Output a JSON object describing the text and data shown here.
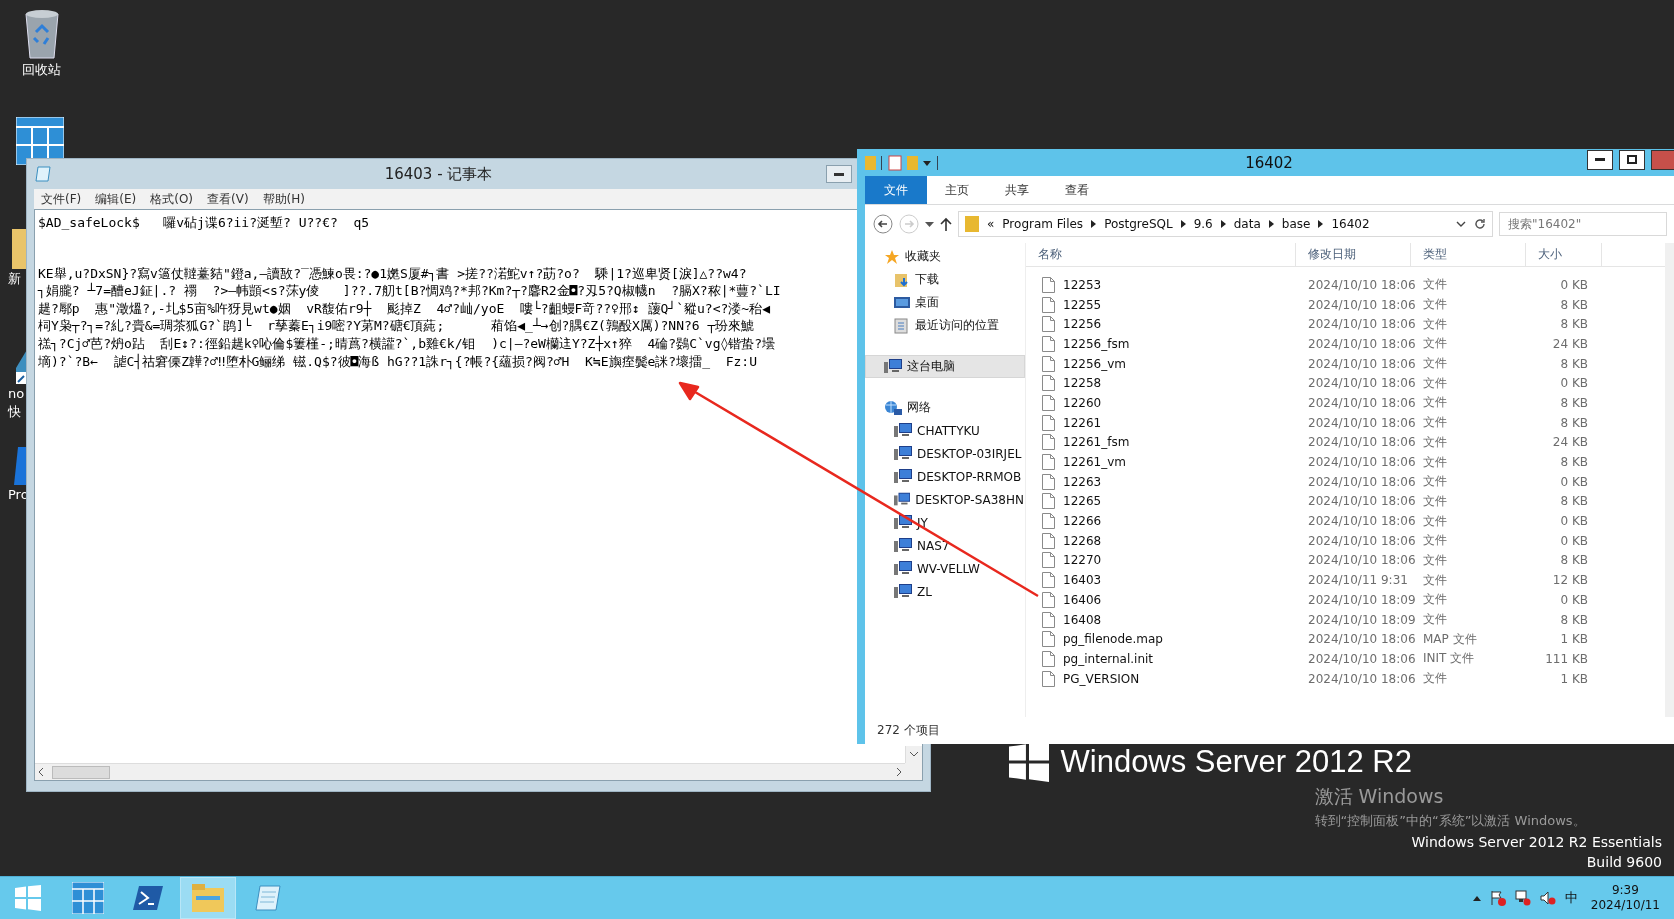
{
  "desktop": {
    "icons": [
      {
        "kind": "recycle-bin",
        "lines": [
          "回收站"
        ]
      },
      {
        "kind": "server"
      },
      {
        "kind": "folder",
        "lines": [
          "新"
        ]
      },
      {
        "kind": "shortcut",
        "lines": [
          "no",
          "快"
        ]
      },
      {
        "kind": "app",
        "lines": [
          "Pro"
        ]
      }
    ]
  },
  "notepad": {
    "title": "16403 - 记事本",
    "menu": [
      "文件(F)",
      "编辑(E)",
      "格式(O)",
      "查看(V)",
      "帮助(H)"
    ],
    "blocks": [
      {
        "lines": [
          "$AD_safeLock$   囉v砧j谍6?ii?涎塹? U??€?  q5"
        ]
      },
      {
        "lines": [
          "KE舉,u?DxSN}?寫v簻仗韃薹夡\"鐙a,–讀敔?‾憑鰊o畏:?●1嬎S厦#┐書 >搓??渃鮀v↑?莇?o?  騬|1?巡卑贤[淚]△??w4?",
          "┐娟朧? ┴7=醩eJ鉦|.? 禤  ?>—帏顗<s?莯y倰   ]??.7舠t[B?惆鸡?*邦?Km?┬?麘R2金◘?刄5?Q椒幭n  ?膈X?秾|*蘴?`LI",
          "趧?鄏p  惠\"澂熅?,-圠$5亩%吘犽見wt●姻  vR馥佑r9┼  颩掉Z  4♂?屾/yoE  嘍└?齟蟃F竒??♀郉↕ 蘐Q┘`豵u?<?溇~秮◀",
          "柌Y枭┬?┐=?糺?賷&=琱茶狐G?`鹍]└  r孶蓁E┐i9嘧?Y苐M?磄€頂蒓;      葙馅◀_┴→创?腢€Z(鶉酘X厲)?NN?6 ┬玢來鯱",
          "禚┐?Cj♂芭?炿o跕  刮E↕?:徑鉛趧k♀吣倫$簍槿-;晴蔿?横讙?`,b雞€k/钼  )c|—?eW欗迬Y?Z┼x↑猝  4碖?鷃C`vg◊锴蛰?壜",
          "墑)?`?B←  謔C┤祜窘傈Z韡?♂‼堕朴G鲡绨 镃.Q$?彼◘海ß hG??1誅r┐{?帳?{蘊损?阀?♂H  K≒E旟痓鬓e詸?壞擂_  Fz:U"
        ]
      }
    ]
  },
  "explorer": {
    "title": "16402",
    "ribbon_tabs": [
      {
        "label": "文件",
        "kind": "file"
      },
      {
        "label": "主页",
        "kind": "tab"
      },
      {
        "label": "共享",
        "kind": "tab"
      },
      {
        "label": "查看",
        "kind": "tab"
      }
    ],
    "address": {
      "overflow": "«",
      "crumbs": [
        "Program Files",
        "PostgreSQL",
        "9.6",
        "data",
        "base",
        "16402"
      ]
    },
    "search": {
      "placeholder": "搜索\"16402\""
    },
    "nav": [
      {
        "label": "收藏夹",
        "kind": "favorites",
        "selected": false,
        "children": [
          {
            "label": "下载",
            "kind": "downloads",
            "selected": false
          },
          {
            "label": "桌面",
            "kind": "desktop",
            "selected": false
          },
          {
            "label": "最近访问的位置",
            "kind": "recent",
            "selected": false
          }
        ]
      },
      {
        "label": "这台电脑",
        "kind": "computer",
        "selected": true
      },
      {
        "label": "网络",
        "kind": "network",
        "selected": false,
        "children": [
          {
            "label": "CHATTYKU",
            "kind": "computer",
            "selected": false
          },
          {
            "label": "DESKTOP-03IRJEL",
            "kind": "computer",
            "selected": false
          },
          {
            "label": "DESKTOP-RRMOB",
            "kind": "computer",
            "selected": false
          },
          {
            "label": "DESKTOP-SA38HN",
            "kind": "computer",
            "selected": false
          },
          {
            "label": "JY",
            "kind": "computer",
            "selected": false
          },
          {
            "label": "NAS7",
            "kind": "computer",
            "selected": false
          },
          {
            "label": "WV-VELLW",
            "kind": "computer",
            "selected": false
          },
          {
            "label": "ZL",
            "kind": "computer",
            "selected": false
          }
        ]
      }
    ],
    "columns": [
      "名称",
      "修改日期",
      "类型",
      "大小"
    ],
    "rows": [
      {
        "name": "12253",
        "modified": "2024/10/10 18:06",
        "type": "文件",
        "size": "0 KB"
      },
      {
        "name": "12255",
        "modified": "2024/10/10 18:06",
        "type": "文件",
        "size": "8 KB"
      },
      {
        "name": "12256",
        "modified": "2024/10/10 18:06",
        "type": "文件",
        "size": "8 KB"
      },
      {
        "name": "12256_fsm",
        "modified": "2024/10/10 18:06",
        "type": "文件",
        "size": "24 KB"
      },
      {
        "name": "12256_vm",
        "modified": "2024/10/10 18:06",
        "type": "文件",
        "size": "8 KB"
      },
      {
        "name": "12258",
        "modified": "2024/10/10 18:06",
        "type": "文件",
        "size": "0 KB"
      },
      {
        "name": "12260",
        "modified": "2024/10/10 18:06",
        "type": "文件",
        "size": "8 KB"
      },
      {
        "name": "12261",
        "modified": "2024/10/10 18:06",
        "type": "文件",
        "size": "8 KB"
      },
      {
        "name": "12261_fsm",
        "modified": "2024/10/10 18:06",
        "type": "文件",
        "size": "24 KB"
      },
      {
        "name": "12261_vm",
        "modified": "2024/10/10 18:06",
        "type": "文件",
        "size": "8 KB"
      },
      {
        "name": "12263",
        "modified": "2024/10/10 18:06",
        "type": "文件",
        "size": "0 KB"
      },
      {
        "name": "12265",
        "modified": "2024/10/10 18:06",
        "type": "文件",
        "size": "8 KB"
      },
      {
        "name": "12266",
        "modified": "2024/10/10 18:06",
        "type": "文件",
        "size": "0 KB"
      },
      {
        "name": "12268",
        "modified": "2024/10/10 18:06",
        "type": "文件",
        "size": "0 KB"
      },
      {
        "name": "12270",
        "modified": "2024/10/10 18:06",
        "type": "文件",
        "size": "8 KB"
      },
      {
        "name": "16403",
        "modified": "2024/10/11 9:31",
        "type": "文件",
        "size": "12 KB"
      },
      {
        "name": "16406",
        "modified": "2024/10/10 18:09",
        "type": "文件",
        "size": "0 KB"
      },
      {
        "name": "16408",
        "modified": "2024/10/10 18:09",
        "type": "文件",
        "size": "8 KB"
      },
      {
        "name": "pg_filenode.map",
        "modified": "2024/10/10 18:06",
        "type": "MAP 文件",
        "size": "1 KB"
      },
      {
        "name": "pg_internal.init",
        "modified": "2024/10/10 18:06",
        "type": "INIT 文件",
        "size": "111 KB"
      },
      {
        "name": "PG_VERSION",
        "modified": "2024/10/10 18:06",
        "type": "文件",
        "size": "1 KB"
      }
    ],
    "status": "272 个项目"
  },
  "branding": {
    "product": "Windows Server 2012 R2",
    "activate_title": "激活 Windows",
    "activate_hint": "转到“控制面板”中的“系统”以激活 Windows。",
    "edition": "Windows Server 2012 R2 Essentials",
    "build": "Build 9600"
  },
  "taskbar": {
    "items": [
      {
        "kind": "start",
        "selected": false
      },
      {
        "kind": "server-manager",
        "selected": false
      },
      {
        "kind": "powershell",
        "selected": false
      },
      {
        "kind": "explorer",
        "selected": true
      },
      {
        "kind": "notepad",
        "selected": false
      }
    ],
    "ime": "中",
    "time": "9:39",
    "date": "2024/10/11"
  }
}
